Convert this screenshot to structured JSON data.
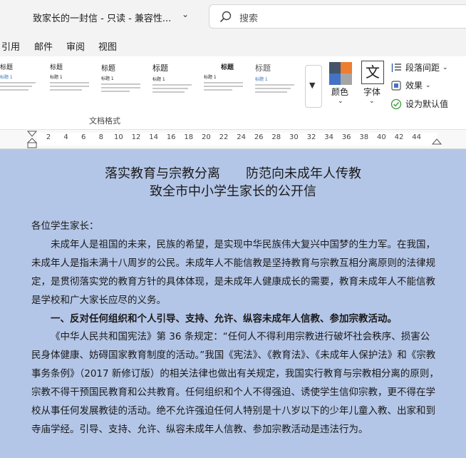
{
  "titlebar": {
    "document_title": "致家长的一封信 - 只读 - 兼容性...",
    "search_placeholder": "搜索"
  },
  "menu": {
    "tabs": [
      "引用",
      "邮件",
      "审阅",
      "视图"
    ]
  },
  "ribbon": {
    "styles": [
      {
        "head": "标题",
        "sub": "标题 1"
      },
      {
        "head": "标题",
        "sub": "标题 1"
      },
      {
        "head": "标题",
        "sub": "标题 1"
      },
      {
        "head": "标题",
        "sub": "标题 1"
      },
      {
        "head": "标题",
        "sub": "标题 1"
      },
      {
        "head": "标题",
        "sub": "标题 1"
      }
    ],
    "group_label": "文档格式",
    "colors_label": "颜色",
    "font_glyph": "文",
    "font_label": "字体",
    "paragraph_spacing": "段落间距",
    "effects": "效果",
    "set_default": "设为默认值"
  },
  "ruler": {
    "ticks": [
      "2",
      "4",
      "6",
      "8",
      "10",
      "12",
      "14",
      "16",
      "18",
      "20",
      "22",
      "24",
      "26",
      "28",
      "30",
      "32",
      "34",
      "36",
      "38",
      "40",
      "42",
      "44"
    ]
  },
  "document": {
    "title_line1": "落实教育与宗教分离　　防范向未成年人传教",
    "title_line2": "致全市中小学生家长的公开信",
    "salutation": "各位学生家长：",
    "para1": "未成年人是祖国的未来，民族的希望，是实现中华民族伟大复兴中国梦的生力军。在我国，未成年人是指未满十八周岁的公民。未成年人不能信教是坚持教育与宗教互相分离原则的法律规定，是贯彻落实党的教育方针的具体体现，是未成年人健康成长的需要，教育未成年人不能信教是学校和广大家长应尽的义务。",
    "heading1": "一、反对任何组织和个人引导、支持、允许、纵容未成年人信教、参加宗教活动。",
    "para2": "《中华人民共和国宪法》第 36 条规定：“任何人不得利用宗教进行破坏社会秩序、损害公民身体健康、妨碍国家教育制度的活动。”我国《宪法》、《教育法》、《未成年人保护法》和《宗教事务条例》（2017 新修订版）的相关法律也做出有关规定，我国实行教育与宗教相分离的原则，宗教不得干预国民教育和公共教育。任何组织和个人不得强迫、诱使学生信仰宗教，更不得在学校从事任何发展教徒的活动。绝不允许强迫任何人特别是十八岁以下的少年儿童入教、出家和到寺庙学经。引导、支持、允许、纵容未成年人信教、参加宗教活动是违法行为。"
  }
}
